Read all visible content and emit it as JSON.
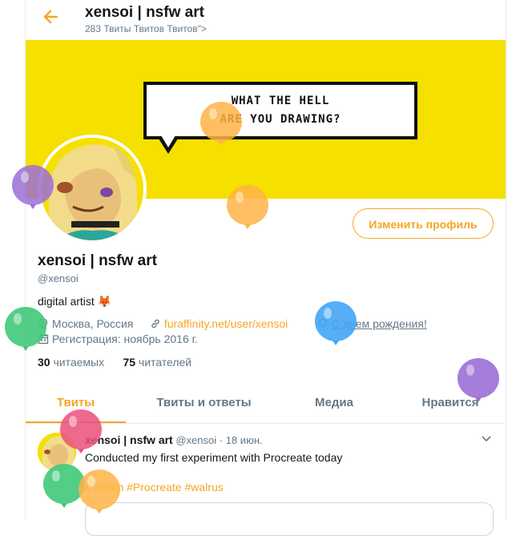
{
  "header": {
    "back_icon": "arrow-left-icon",
    "title": "xensoi | nsfw art",
    "subtitle": "283 Твиты Твитов Твитов\">"
  },
  "banner": {
    "line1": "WHAT THE HELL",
    "line2": "ARE YOU DRAWING?",
    "background": "#f5e000"
  },
  "profile": {
    "edit_label": "Изменить профиль",
    "name": "xensoi | nsfw art",
    "handle": "@xensoi",
    "bio": "digital artist",
    "bio_emoji": "🦊",
    "location": "Москва, Россия",
    "website": "furaffinity.net/user/xensoi",
    "birthday": "С днем рождения!",
    "joined": "Регистрация: ноябрь 2016 г.",
    "following_count": "30",
    "following_label": "читаемых",
    "followers_count": "75",
    "followers_label": "читателей"
  },
  "tabs": [
    {
      "label": "Твиты",
      "active": true
    },
    {
      "label": "Твиты и ответы",
      "active": false
    },
    {
      "label": "Медиа",
      "active": false
    },
    {
      "label": "Нравится",
      "active": false
    }
  ],
  "tweet": {
    "name": "xensoi | nsfw art",
    "handle": "@xensoi",
    "sep": "·",
    "date": "18 июн.",
    "text": "Conducted my first experiment with Procreate today",
    "tags": "#sketch #Procreate #walrus",
    "caret_icon": "chevron-down-icon"
  },
  "colors": {
    "accent": "#f5a623",
    "muted": "#657786",
    "text": "#14171a",
    "balloon_purple": "#9b6fd6",
    "balloon_orange": "#ffb347",
    "balloon_green": "#3fc97a",
    "balloon_blue": "#42a5f5",
    "balloon_pink": "#ec4f7a"
  }
}
